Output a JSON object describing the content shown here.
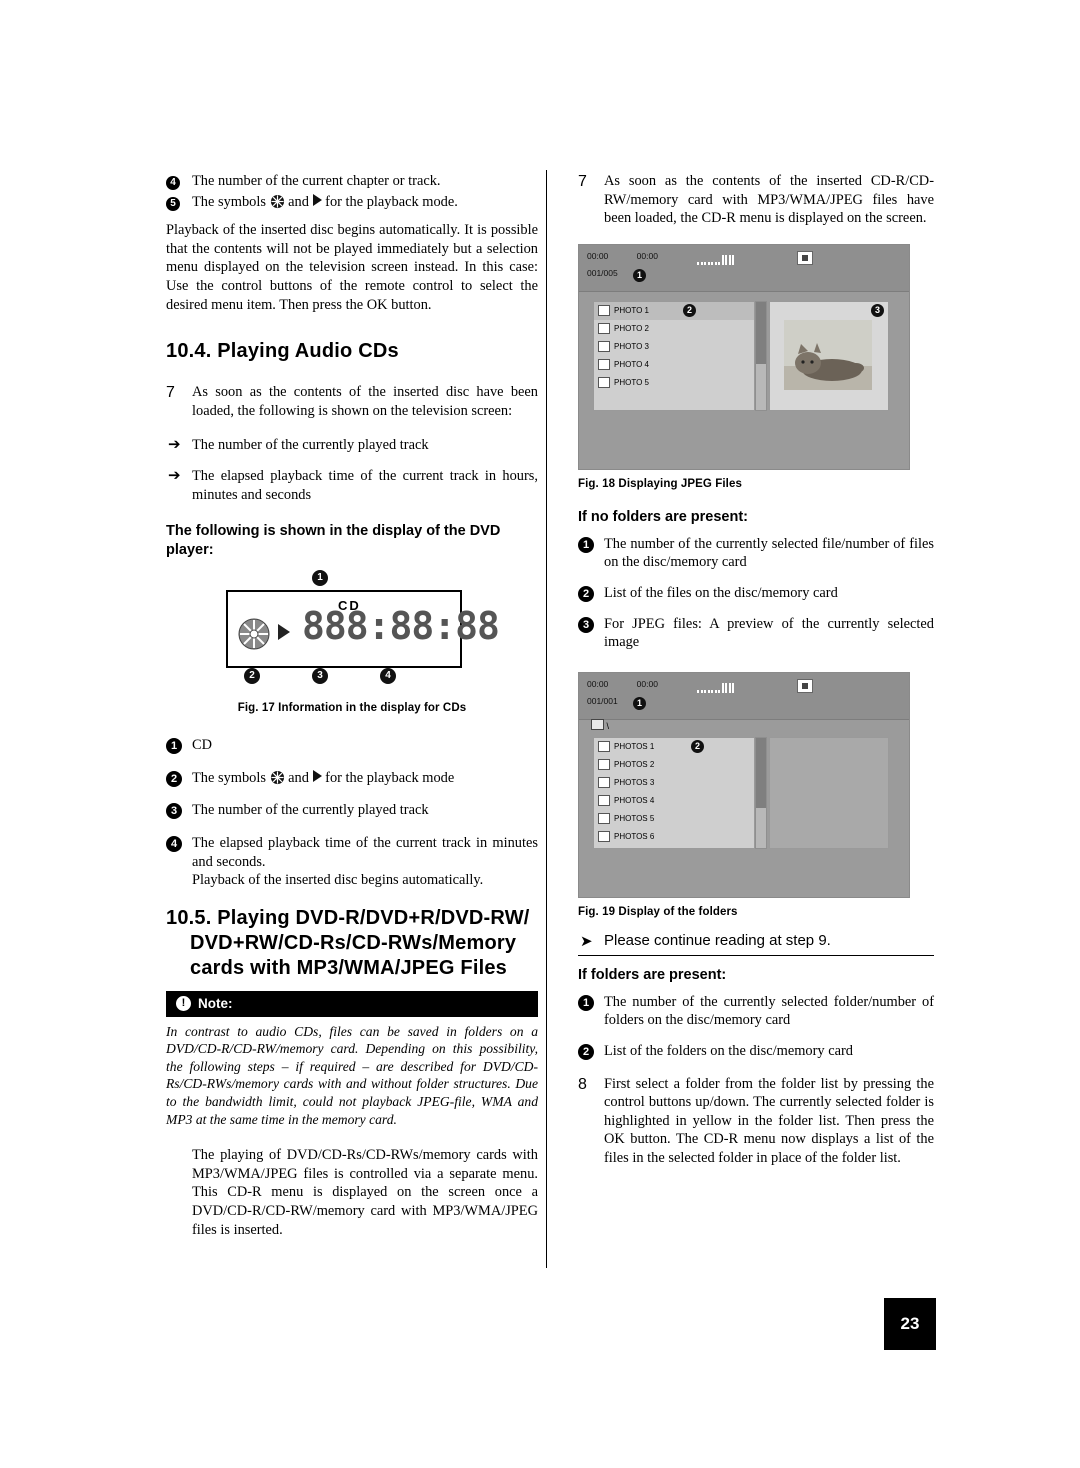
{
  "page_number": "23",
  "left": {
    "item4": "The number of the current chapter or track.",
    "item5_pre": "The symbols",
    "item5_mid": "and",
    "item5_post": "for the playback mode.",
    "para_playback": "Playback of the inserted disc begins automatically. It is possible that the contents will not be played immediately but a selection menu displayed on the television screen instead. In this case: Use the control buttons of the remote control to select the desired menu item. Then press the OK button.",
    "heading_10_4": "10.4. Playing Audio CDs",
    "step7_num": "7",
    "step7_text": "As soon as the contents of the inserted disc have been loaded, the following is shown on the television screen:",
    "arrow1": "The number of the currently played track",
    "arrow2": "The elapsed playback time of the current track in hours, minutes and seconds",
    "subhead_display": "The following is shown in the display of the DVD player:",
    "display": {
      "cd_label": "CD",
      "segments": "888:88:88",
      "badge1": "1",
      "badge2": "2",
      "badge3": "3",
      "badge4": "4"
    },
    "fig17_caption": "Fig. 17 Information in the display for CDs",
    "list": [
      {
        "num": "1",
        "text": "CD"
      },
      {
        "num": "2",
        "text": "The symbols  and  for the playback mode"
      },
      {
        "num": "3",
        "text": "The number of the currently played track"
      },
      {
        "num": "4",
        "text": "The elapsed playback time of the current track in minutes and seconds."
      }
    ],
    "item2_pre": "The symbols",
    "item2_mid": "and",
    "item2_post": "for the playback mode",
    "para_auto": "Playback of the inserted disc begins automatically.",
    "heading_10_5_line1": "10.5. Playing DVD-R/DVD+R/DVD-RW/",
    "heading_10_5_line2": "DVD+RW/CD-Rs/CD-RWs/Memory",
    "heading_10_5_line3": "cards with MP3/WMA/JPEG Files",
    "note_title": "Note:",
    "note_icon": "!",
    "note_body": "In contrast to audio CDs, files can be saved in folders on a DVD/CD-R/CD-RW/memory card. Depending on this possibility, the following steps – if required – are described for DVD/CD-Rs/CD-RWs/memory cards with and without folder structures. Due to the bandwidth limit, could not playback JPEG-file, WMA and MP3 at the same time in the memory card.",
    "para_playing": "The playing of DVD/CD-Rs/CD-RWs/memory cards with MP3/WMA/JPEG files is controlled via a separate menu. This CD-R menu is displayed on the screen once a DVD/CD-R/CD-RW/memory card with MP3/WMA/JPEG files is inserted."
  },
  "right": {
    "step7_num": "7",
    "step7_text": "As soon as the contents of the inserted CD-R/CD-RW/memory card with MP3/WMA/JPEG files have been loaded, the CD-R menu is displayed on the screen.",
    "tv1": {
      "time_left": "00:00",
      "time_right": "00:00",
      "counter": "001/005",
      "badge_counter": "1",
      "badge_list": "2",
      "badge_preview": "3",
      "files": [
        "PHOTO 1",
        "PHOTO 2",
        "PHOTO 3",
        "PHOTO 4",
        "PHOTO 5"
      ]
    },
    "fig18_caption": "Fig. 18 Displaying JPEG Files",
    "subhead_nofolders": "If no folders are present:",
    "nofolders_list": [
      {
        "num": "1",
        "text": "The number of the currently selected file/number of files on the disc/memory card"
      },
      {
        "num": "2",
        "text": "List of the files on the disc/memory card"
      },
      {
        "num": "3",
        "text": "For JPEG files: A preview of the currently selected image"
      }
    ],
    "tv2": {
      "time_left": "00:00",
      "time_right": "00:00",
      "counter": "001/001",
      "badge_counter": "1",
      "badge_list": "2",
      "breadcrumb": "\\",
      "files": [
        "PHOTOS 1",
        "PHOTOS 2",
        "PHOTOS 3",
        "PHOTOS 4",
        "PHOTOS 5",
        "PHOTOS 6"
      ]
    },
    "fig19_caption": "Fig. 19 Display of the folders",
    "continue_text": "Please continue reading at step 9.",
    "subhead_folders": "If folders are present:",
    "folders_list": [
      {
        "num": "1",
        "text": "The number of the currently selected folder/number of folders on the disc/memory card"
      },
      {
        "num": "2",
        "text": "List of the folders on the disc/memory card"
      }
    ],
    "step8_num": "8",
    "step8_text": "First select a folder from the folder list by pressing the control buttons up/down. The currently selected folder is highlighted in yellow in the folder list. Then press the OK button. The CD-R menu now displays a list of the files in the selected folder in place of the folder list."
  }
}
